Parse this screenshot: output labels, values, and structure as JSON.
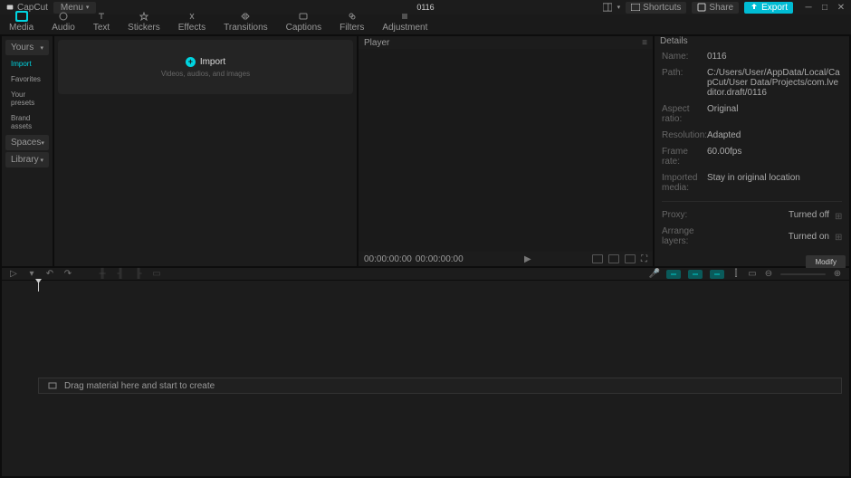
{
  "titlebar": {
    "app": "CapCut",
    "menu": "Menu",
    "project": "0116",
    "shortcuts": "Shortcuts",
    "share": "Share",
    "export": "Export"
  },
  "toolbar": {
    "items": [
      {
        "label": "Media"
      },
      {
        "label": "Audio"
      },
      {
        "label": "Text"
      },
      {
        "label": "Stickers"
      },
      {
        "label": "Effects"
      },
      {
        "label": "Transitions"
      },
      {
        "label": "Captions"
      },
      {
        "label": "Filters"
      },
      {
        "label": "Adjustment"
      }
    ]
  },
  "sidebar": {
    "yours": "Yours",
    "import": "Import",
    "favorites": "Favorites",
    "presets": "Your presets",
    "brand": "Brand assets",
    "spaces": "Spaces",
    "library": "Library"
  },
  "import_box": {
    "title": "Import",
    "subtitle": "Videos, audios, and images"
  },
  "player": {
    "title": "Player",
    "time1": "00:00:00:00",
    "time2": "00:00:00:00"
  },
  "details": {
    "title": "Details",
    "name_label": "Name:",
    "name_value": "0116",
    "path_label": "Path:",
    "path_value": "C:/Users/User/AppData/Local/CapCut/User Data/Projects/com.lveditor.draft/0116",
    "aspect_label": "Aspect ratio:",
    "aspect_value": "Original",
    "resolution_label": "Resolution:",
    "resolution_value": "Adapted",
    "framerate_label": "Frame rate:",
    "framerate_value": "60.00fps",
    "imported_label": "Imported media:",
    "imported_value": "Stay in original location",
    "proxy_label": "Proxy:",
    "proxy_value": "Turned off",
    "arrange_label": "Arrange layers:",
    "arrange_value": "Turned on",
    "modify": "Modify"
  },
  "timeline": {
    "drop_hint": "Drag material here and start to create"
  }
}
